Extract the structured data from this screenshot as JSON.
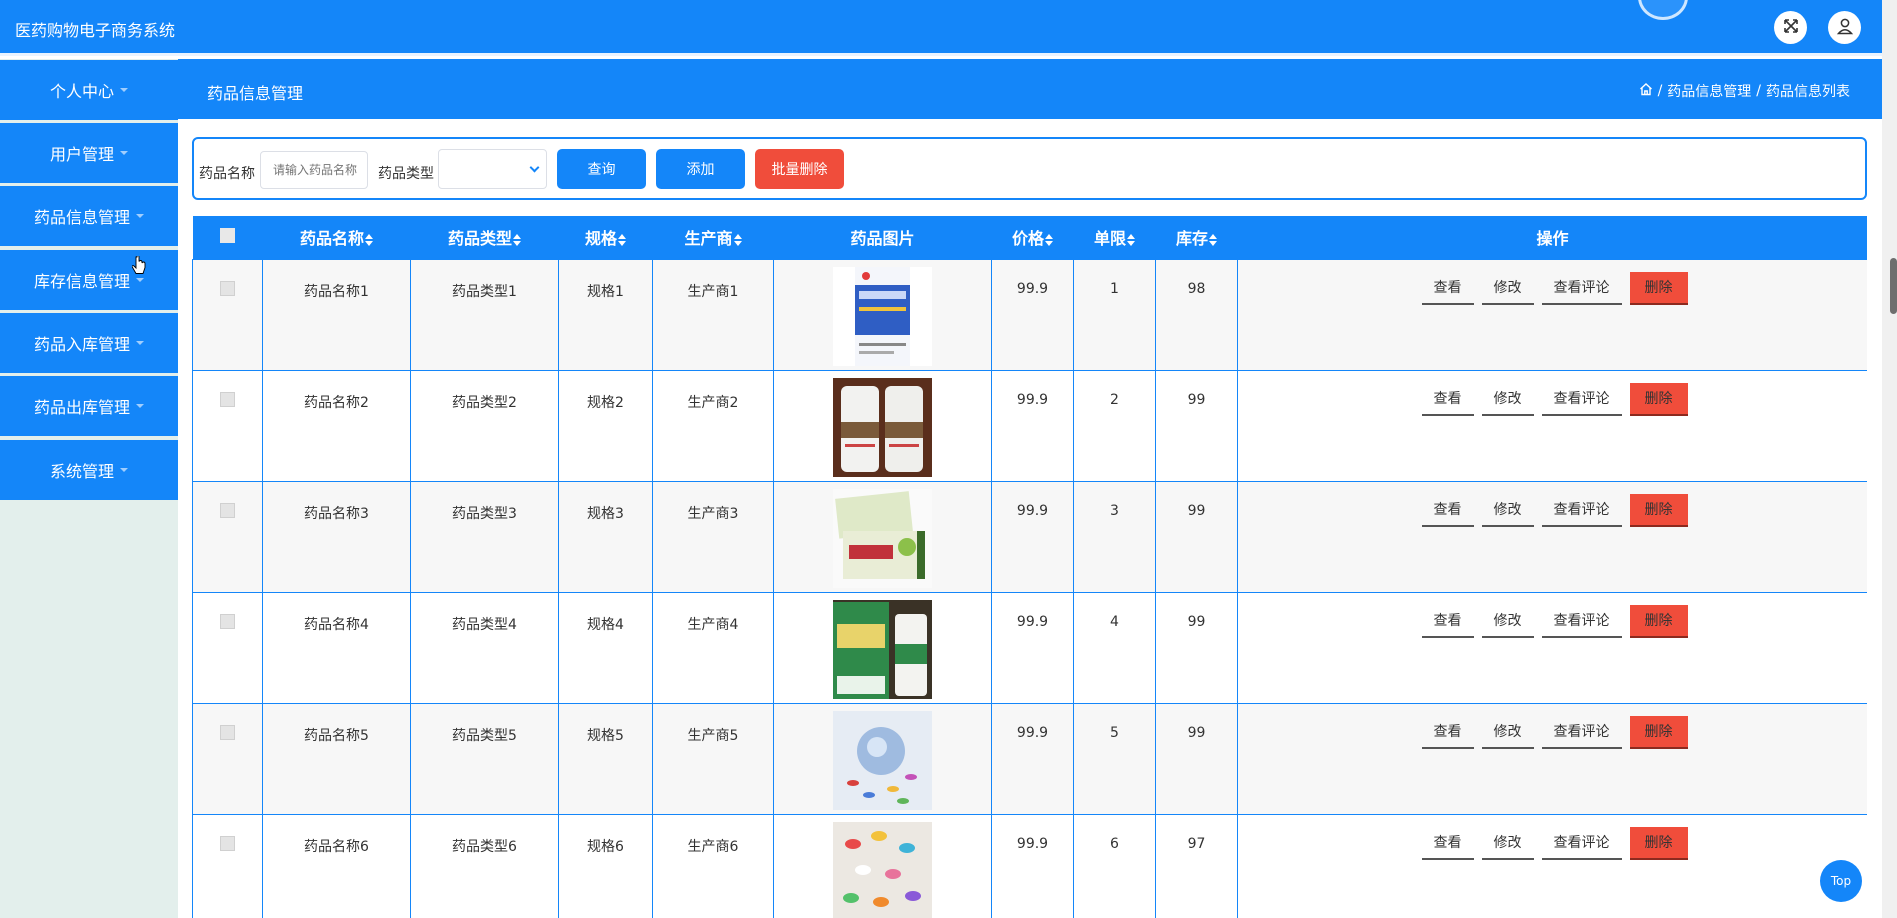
{
  "app": {
    "title": "医药购物电子商务系统"
  },
  "sidebar": {
    "items": [
      {
        "label": "个人中心"
      },
      {
        "label": "用户管理"
      },
      {
        "label": "药品信息管理"
      },
      {
        "label": "库存信息管理"
      },
      {
        "label": "药品入库管理"
      },
      {
        "label": "药品出库管理"
      },
      {
        "label": "系统管理"
      }
    ]
  },
  "header": {
    "title": "药品信息管理",
    "breadcrumb": [
      "药品信息管理",
      "药品信息列表"
    ],
    "separator": "/"
  },
  "search": {
    "name_label": "药品名称",
    "name_placeholder": "请输入药品名称",
    "type_label": "药品类型",
    "type_value": "",
    "query_button": "查询",
    "add_button": "添加",
    "batch_delete_button": "批量删除"
  },
  "table": {
    "columns": [
      "药品名称",
      "药品类型",
      "规格",
      "生产商",
      "药品图片",
      "价格",
      "单限",
      "库存",
      "操作"
    ],
    "rows": [
      {
        "name": "药品名称1",
        "type": "药品类型1",
        "spec": "规格1",
        "maker": "生产商1",
        "price": "99.9",
        "limit": "1",
        "stock": "98"
      },
      {
        "name": "药品名称2",
        "type": "药品类型2",
        "spec": "规格2",
        "maker": "生产商2",
        "price": "99.9",
        "limit": "2",
        "stock": "99"
      },
      {
        "name": "药品名称3",
        "type": "药品类型3",
        "spec": "规格3",
        "maker": "生产商3",
        "price": "99.9",
        "limit": "3",
        "stock": "99"
      },
      {
        "name": "药品名称4",
        "type": "药品类型4",
        "spec": "规格4",
        "maker": "生产商4",
        "price": "99.9",
        "limit": "4",
        "stock": "99"
      },
      {
        "name": "药品名称5",
        "type": "药品类型5",
        "spec": "规格5",
        "maker": "生产商5",
        "price": "99.9",
        "limit": "5",
        "stock": "99"
      },
      {
        "name": "药品名称6",
        "type": "药品类型6",
        "spec": "规格6",
        "maker": "生产商6",
        "price": "99.9",
        "limit": "6",
        "stock": "97"
      }
    ],
    "actions": {
      "view": "查看",
      "edit": "修改",
      "reviews": "查看评论",
      "delete": "删除"
    }
  },
  "top_button": "Top",
  "colors": {
    "primary": "#1486f9",
    "danger": "#f04d3b",
    "sidebar_bg": "#e3efec"
  },
  "icons": [
    "expand-icon",
    "user-icon",
    "home-icon",
    "cursor-pointer-icon"
  ]
}
